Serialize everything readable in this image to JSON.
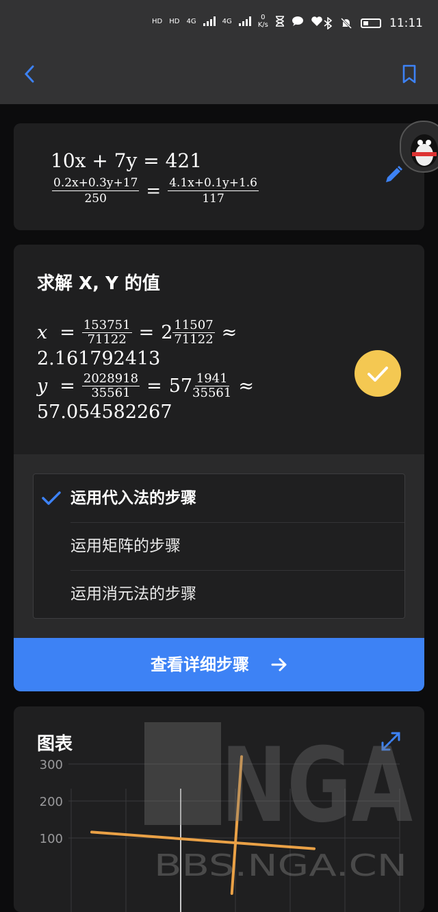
{
  "status_bar": {
    "left_icons": [
      "HD",
      "HD",
      "4G",
      "4G",
      "0",
      "K/s"
    ],
    "time": "11:11"
  },
  "app_bar": {
    "back_icon": "chevron-left-icon",
    "bookmark_icon": "bookmark-icon"
  },
  "equation": {
    "line1": "10x + 7y = 421",
    "lhs_num": "0.2x+0.3y+17",
    "lhs_den": "250",
    "equals": "=",
    "rhs_num": "4.1x+0.1y+1.6",
    "rhs_den": "117"
  },
  "solution": {
    "title": "求解 X, Y 的值",
    "x": {
      "var": "x",
      "frac_num": "153751",
      "frac_den": "71122",
      "whole": "2",
      "mixed_num": "11507",
      "mixed_den": "71122",
      "decimal": "2.161792413"
    },
    "y": {
      "var": "y",
      "frac_num": "2028918",
      "frac_den": "35561",
      "whole": "57",
      "mixed_num": "1941",
      "mixed_den": "35561",
      "decimal": "57.054582267"
    },
    "eq_sign": "=",
    "approx_sign": "≈"
  },
  "steps": {
    "items": [
      {
        "label": "运用代入法的步骤",
        "selected": true
      },
      {
        "label": "运用矩阵的步骤",
        "selected": false
      },
      {
        "label": "运用消元法的步骤",
        "selected": false
      }
    ],
    "button_label": "查看详细步骤"
  },
  "graph": {
    "title": "图表",
    "expand_icon": "expand-icon"
  },
  "chart_data": {
    "type": "line",
    "y_ticks": [
      "300",
      "200",
      "100"
    ],
    "series": [
      {
        "values": [
          [
            -20,
            116
          ],
          [
            30,
            71
          ]
        ]
      },
      {
        "values": [
          [
            11.5,
            -50
          ],
          [
            13.7,
            320
          ]
        ]
      }
    ],
    "grid": true
  },
  "watermark": {
    "text": "NGA",
    "subtext": "BBS.NGA.CN"
  },
  "colors": {
    "accent_blue": "#3d82f5",
    "check_yellow": "#f4c852",
    "line_orange": "#eaa146"
  }
}
